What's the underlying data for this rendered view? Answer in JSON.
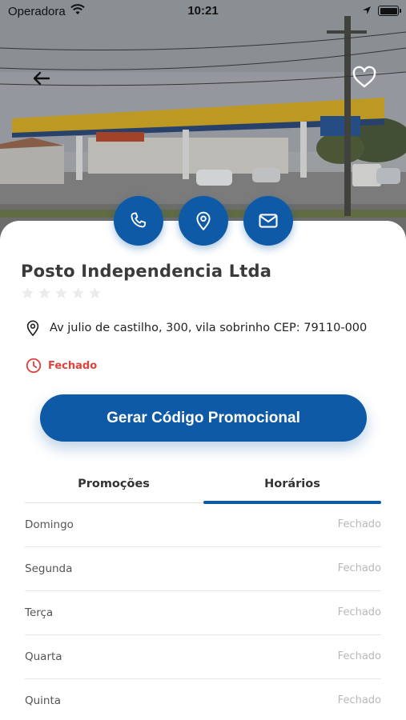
{
  "status_bar": {
    "carrier": "Operadora",
    "time": "10:21"
  },
  "colors": {
    "primary": "#0f5aa6",
    "closed_red": "#e0433b",
    "muted_text": "#b8b8b8"
  },
  "header": {
    "back_icon": "arrow-left-icon",
    "favorite_icon": "heart-outline-icon"
  },
  "actions": [
    {
      "icon": "phone-icon"
    },
    {
      "icon": "map-pin-icon"
    },
    {
      "icon": "mail-icon"
    }
  ],
  "station": {
    "name": "Posto Independencia Ltda",
    "rating": 0,
    "rating_max": 5,
    "address": "Av julio de castilho, 300, vila sobrinho CEP: 79110-000",
    "status": "Fechado"
  },
  "promo_button_label": "Gerar Código Promocional",
  "tabs": [
    {
      "label": "Promoções",
      "active": false
    },
    {
      "label": "Horários",
      "active": true
    }
  ],
  "hours": [
    {
      "day": "Domingo",
      "value": "Fechado"
    },
    {
      "day": "Segunda",
      "value": "Fechado"
    },
    {
      "day": "Terça",
      "value": "Fechado"
    },
    {
      "day": "Quarta",
      "value": "Fechado"
    },
    {
      "day": "Quinta",
      "value": "Fechado"
    }
  ]
}
